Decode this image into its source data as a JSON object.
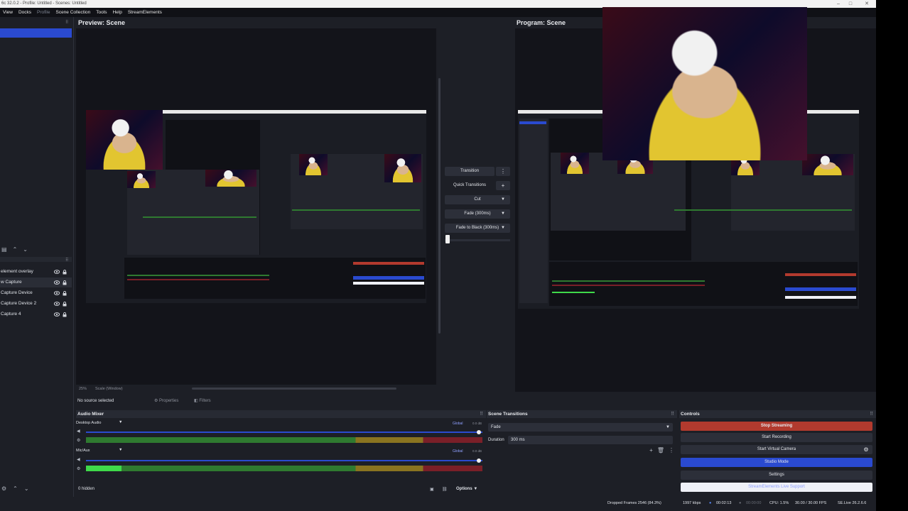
{
  "window": {
    "title": "6c 32.0.2 - Profile: Untitled - Scenes: Untitled"
  },
  "menu": [
    "View",
    "Docks",
    "Profile",
    "Scene Collection",
    "Tools",
    "Help",
    "StreamElements"
  ],
  "sources": [
    {
      "label": "element overlay",
      "selected": false
    },
    {
      "label": "w Capture",
      "selected": true
    },
    {
      "label": "Capture Device",
      "selected": false
    },
    {
      "label": "Capture Device 2",
      "selected": false
    },
    {
      "label": "Capture 4",
      "selected": false
    }
  ],
  "preview": {
    "title": "Preview: Scene"
  },
  "program": {
    "title": "Program: Scene"
  },
  "preview_footer": {
    "zoom": "25%",
    "mode": "Scale (Window)"
  },
  "transition": {
    "transition_label": "Transition",
    "quick_label": "Quick Transitions",
    "cut_label": "Cut",
    "fade_label": "Fade (300ms)",
    "fade_black_label": "Fade to Black (300ms)"
  },
  "source_status": {
    "text": "No source selected",
    "properties": "Properties",
    "filters": "Filters"
  },
  "audio_mixer": {
    "title": "Audio Mixer",
    "channels": [
      {
        "name": "Desktop Audio",
        "db": "0.0 dB",
        "global": "Global",
        "level": 0.0
      },
      {
        "name": "Mic/Aux",
        "db": "0.0 dB",
        "global": "Global",
        "level": 0.09
      }
    ],
    "hidden": "0 hidden",
    "options": "Options"
  },
  "scene_transitions": {
    "title": "Scene Transitions",
    "type": "Fade",
    "duration_label": "Duration",
    "duration": "300 ms"
  },
  "controls": {
    "title": "Controls",
    "stop_streaming": "Stop Streaming",
    "start_recording": "Start Recording",
    "start_virtual_camera": "Start Virtual Camera",
    "studio_mode": "Studio Mode",
    "settings": "Settings",
    "se_live": "StreamElements Live Support"
  },
  "status": {
    "dropped": "Dropped Frames 2546 (84.3%)",
    "kbps": "1997 kbps",
    "live_time": "00:02:13",
    "rec_time": "00:00:00",
    "cpu": "CPU: 1.5%",
    "fps": "30.00 / 30.00 FPS",
    "version": "SE.Live 26.2.6.6"
  },
  "colors": {
    "accent": "#2a4ad0",
    "stop": "#b23a2e",
    "bg": "#1d1f26"
  }
}
